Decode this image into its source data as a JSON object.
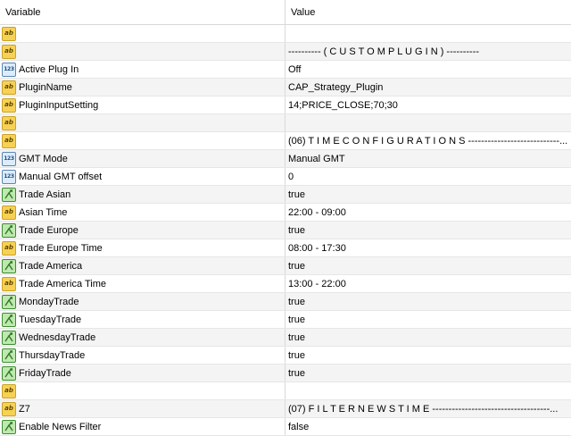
{
  "header": {
    "variable": "Variable",
    "value": "Value"
  },
  "rows": [
    {
      "icon": "ab",
      "name": "",
      "value": ""
    },
    {
      "icon": "ab",
      "name": "",
      "value": "---------- ( C U S T O M   P L U G I N ) ----------"
    },
    {
      "icon": "123",
      "name": "Active Plug In",
      "value": "Off"
    },
    {
      "icon": "ab",
      "name": "PluginName",
      "value": "CAP_Strategy_Plugin"
    },
    {
      "icon": "ab",
      "name": "PluginInputSetting",
      "value": "14;PRICE_CLOSE;70;30"
    },
    {
      "icon": "ab",
      "name": "",
      "value": ""
    },
    {
      "icon": "ab",
      "name": "",
      "value": "(06) T I M E   C O N F I G U R A T I O N S ----------------------------..."
    },
    {
      "icon": "123",
      "name": "GMT Mode",
      "value": "Manual GMT"
    },
    {
      "icon": "123",
      "name": "Manual GMT offset",
      "value": "0"
    },
    {
      "icon": "bool",
      "name": "Trade Asian",
      "value": "true"
    },
    {
      "icon": "ab",
      "name": "Asian Time",
      "value": "22:00 - 09:00"
    },
    {
      "icon": "bool",
      "name": "Trade Europe",
      "value": "true"
    },
    {
      "icon": "ab",
      "name": "Trade Europe Time",
      "value": "08:00 - 17:30"
    },
    {
      "icon": "bool",
      "name": "Trade America",
      "value": "true"
    },
    {
      "icon": "ab",
      "name": "Trade America Time",
      "value": "13:00 - 22:00"
    },
    {
      "icon": "bool",
      "name": "MondayTrade",
      "value": "true"
    },
    {
      "icon": "bool",
      "name": "TuesdayTrade",
      "value": "true"
    },
    {
      "icon": "bool",
      "name": "WednesdayTrade",
      "value": "true"
    },
    {
      "icon": "bool",
      "name": "ThursdayTrade",
      "value": "true"
    },
    {
      "icon": "bool",
      "name": "FridayTrade",
      "value": "true"
    },
    {
      "icon": "ab",
      "name": "",
      "value": ""
    },
    {
      "icon": "ab",
      "name": "Z7",
      "value": "(07) F I L T E R   N E W S   T I M E ------------------------------------..."
    },
    {
      "icon": "bool",
      "name": "Enable News Filter",
      "value": "false"
    }
  ],
  "icons": {
    "ab": {
      "label": "ab",
      "name": "string-type-icon"
    },
    "123": {
      "label": "123",
      "name": "integer-type-icon"
    },
    "bool": {
      "label": "",
      "name": "boolean-type-icon"
    }
  },
  "colors": {
    "alt_row": "#f4f4f4",
    "string_icon": "#f7d154",
    "integer_icon": "#dcecfb",
    "boolean_icon": "#bfe8b0"
  }
}
